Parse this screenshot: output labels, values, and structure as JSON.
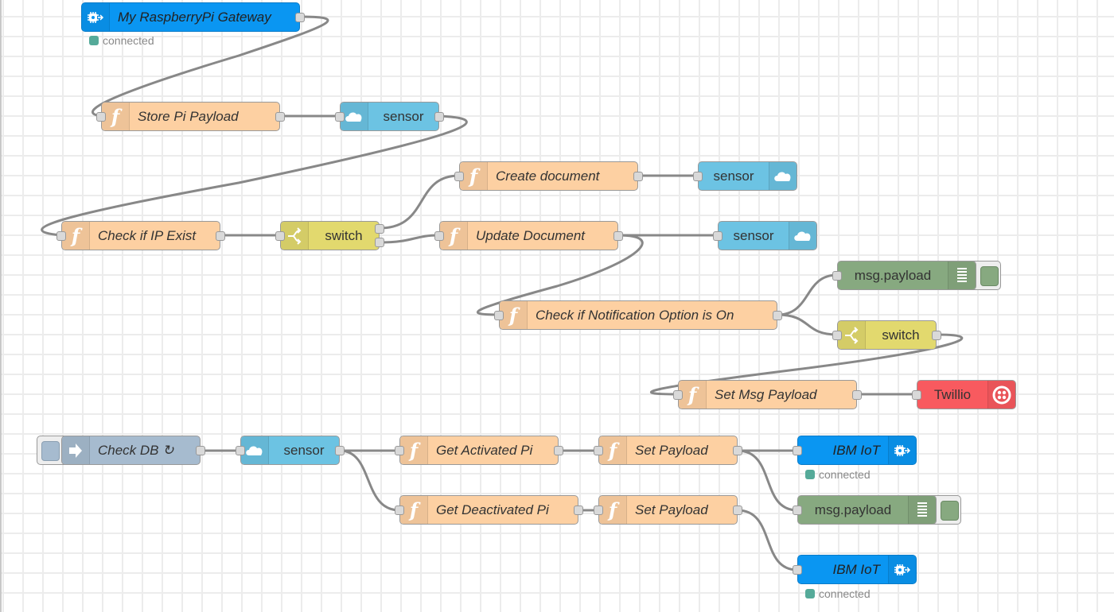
{
  "app": "Node-RED flow editor",
  "colors": {
    "function": "#fdd0a2",
    "cloudant": "#6cc3e3",
    "switch": "#e2d96e",
    "debug": "#87a980",
    "ibmiot": "#0a96f2",
    "inject": "#a6bbcf",
    "twilio": "#f85a5f",
    "status_connected": "#55aa99",
    "wire": "#888888"
  },
  "nodes": {
    "gateway": {
      "label": "My RaspberryPi Gateway",
      "type": "ibmiot-in",
      "icon": "chip-icon",
      "status": "connected"
    },
    "store_pi_payload": {
      "label": "Store Pi Payload",
      "type": "function",
      "icon": "function-icon"
    },
    "sensor1": {
      "label": "sensor",
      "type": "cloudant-in",
      "icon": "cloud-icon"
    },
    "create_document": {
      "label": "Create document",
      "type": "function",
      "icon": "function-icon"
    },
    "sensor2": {
      "label": "sensor",
      "type": "cloudant-out",
      "icon": "cloud-icon"
    },
    "check_ip": {
      "label": "Check if IP Exist",
      "type": "function",
      "icon": "function-icon"
    },
    "switch1": {
      "label": "switch",
      "type": "switch",
      "icon": "switch-icon"
    },
    "update_document": {
      "label": "Update Document",
      "type": "function",
      "icon": "function-icon"
    },
    "sensor3": {
      "label": "sensor",
      "type": "cloudant-out",
      "icon": "cloud-icon"
    },
    "debug1": {
      "label": "msg.payload",
      "type": "debug",
      "icon": "list-icon"
    },
    "check_notification": {
      "label": "Check if Notification Option is On",
      "type": "function",
      "icon": "function-icon"
    },
    "switch2": {
      "label": "switch",
      "type": "switch",
      "icon": "switch-icon"
    },
    "set_msg_payload": {
      "label": "Set Msg Payload",
      "type": "function",
      "icon": "function-icon"
    },
    "twilio": {
      "label": "Twillio",
      "type": "twilio-out",
      "icon": "twilio-icon"
    },
    "check_db": {
      "label": "Check DB ↻",
      "type": "inject",
      "icon": "arrow-right-icon"
    },
    "sensor4": {
      "label": "sensor",
      "type": "cloudant-in",
      "icon": "cloud-icon"
    },
    "get_activated": {
      "label": "Get Activated Pi",
      "type": "function",
      "icon": "function-icon"
    },
    "set_payload1": {
      "label": "Set Payload",
      "type": "function",
      "icon": "function-icon"
    },
    "ibm_iot1": {
      "label": "IBM IoT",
      "type": "ibmiot-out",
      "icon": "chip-icon",
      "status": "connected"
    },
    "debug2": {
      "label": "msg.payload",
      "type": "debug",
      "icon": "list-icon"
    },
    "get_deactivated": {
      "label": "Get Deactivated Pi",
      "type": "function",
      "icon": "function-icon"
    },
    "set_payload2": {
      "label": "Set Payload",
      "type": "function",
      "icon": "function-icon"
    },
    "ibm_iot2": {
      "label": "IBM IoT",
      "type": "ibmiot-out",
      "icon": "chip-icon",
      "status": "connected"
    }
  },
  "wires": [
    [
      "gateway",
      "store_pi_payload"
    ],
    [
      "store_pi_payload",
      "sensor1"
    ],
    [
      "sensor1",
      "check_ip"
    ],
    [
      "check_ip",
      "switch1"
    ],
    [
      "switch1:0",
      "create_document"
    ],
    [
      "switch1:1",
      "update_document"
    ],
    [
      "create_document",
      "sensor2"
    ],
    [
      "update_document",
      "sensor3"
    ],
    [
      "update_document",
      "check_notification"
    ],
    [
      "check_notification",
      "debug1"
    ],
    [
      "check_notification",
      "switch2"
    ],
    [
      "switch2",
      "set_msg_payload"
    ],
    [
      "set_msg_payload",
      "twilio"
    ],
    [
      "check_db",
      "sensor4"
    ],
    [
      "sensor4",
      "get_activated"
    ],
    [
      "sensor4",
      "get_deactivated"
    ],
    [
      "get_activated",
      "set_payload1"
    ],
    [
      "get_deactivated",
      "set_payload2"
    ],
    [
      "set_payload1",
      "ibm_iot1"
    ],
    [
      "set_payload1",
      "debug2"
    ],
    [
      "set_payload2",
      "ibm_iot2"
    ]
  ]
}
